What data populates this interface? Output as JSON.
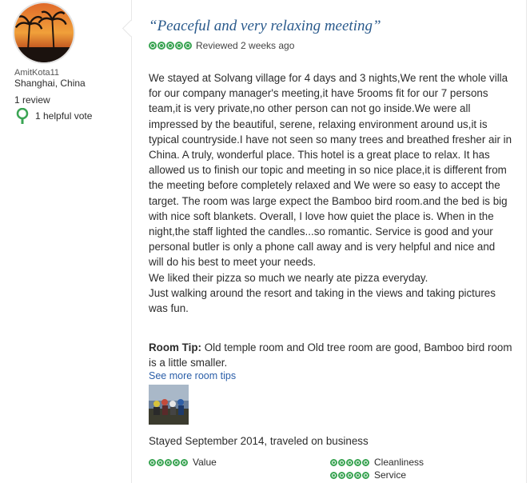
{
  "user": {
    "name": "AmitKota11",
    "location": "Shanghai, China",
    "reviews": "1 review",
    "helpful": "1 helpful vote"
  },
  "review": {
    "title": "“Peaceful and very relaxing meeting”",
    "rating": 5,
    "reviewed": "Reviewed 2 weeks ago",
    "body": [
      "We stayed at Solvang village for 4 days and 3 nights,We rent the whole villa for our company manager's meeting,it have 5rooms fit for our 7 persons team,it is very private,no other person can not go inside.We were all impressed by the beautiful, serene, relaxing environment around us,it is typical countryside.I have not seen so many trees and breathed fresher air in China. A truly, wonderful place. This hotel is a great place to relax. It has allowed us to finish our topic and meeting in so nice place,it is different from the meeting before completely relaxed and We were so easy to accept the target. The room was large expect the Bamboo bird room.and the bed is big with nice soft blankets. Overall, I love how quiet the place is. When in the night,the staff lighted the candles...so romantic. Service is good and your personal butler is only a phone call away and is very helpful and nice and will do his best to meet your needs.",
      "We liked their pizza so much we nearly ate pizza everyday.",
      "Just walking around the resort and taking in the views and taking pictures was fun."
    ],
    "room_tip_label": "Room Tip:",
    "room_tip": "Old temple room and Old tree room are good, Bamboo bird room is a little smaller.",
    "more_tips": "See more room tips",
    "stayed": "Stayed September 2014, traveled on business",
    "subratings": [
      {
        "label": "Value",
        "rating": 5
      },
      {
        "label": "Cleanliness",
        "rating": 5
      },
      {
        "label": "Service",
        "rating": 5
      }
    ]
  },
  "colors": {
    "bubble": "#3aa453",
    "title": "#2a5a8c",
    "link": "#2a5ea8"
  }
}
